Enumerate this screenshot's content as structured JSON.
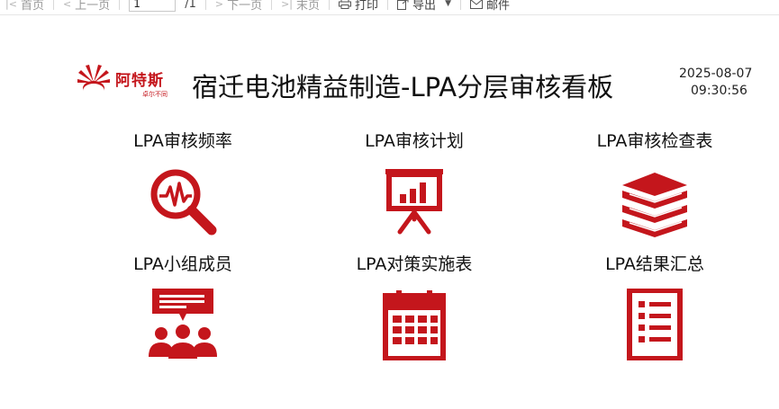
{
  "toolbar": {
    "first_page": "首页",
    "prev_page": "上一页",
    "page_input": "1",
    "page_total": "/1",
    "next_page": "下一页",
    "last_page": "末页",
    "print": "打印",
    "export": "导出",
    "email": "邮件"
  },
  "header": {
    "brand_name": "阿特斯",
    "brand_sub": "卓尔不同",
    "title": "宿迁电池精益制造-LPA分层审核看板",
    "date": "2025-08-07",
    "time": "09:30:56"
  },
  "tiles": [
    {
      "label": "LPA审核频率",
      "icon": "magnifier-pulse-icon"
    },
    {
      "label": "LPA审核计划",
      "icon": "presentation-chart-icon"
    },
    {
      "label": "LPA审核检查表",
      "icon": "book-stack-icon"
    },
    {
      "label": "LPA小组成员",
      "icon": "team-meeting-icon"
    },
    {
      "label": "LPA对策实施表",
      "icon": "calendar-icon"
    },
    {
      "label": "LPA结果汇总",
      "icon": "checklist-icon"
    }
  ],
  "colors": {
    "accent": "#c4161c",
    "toolbar_text": "#9a9a9a"
  }
}
